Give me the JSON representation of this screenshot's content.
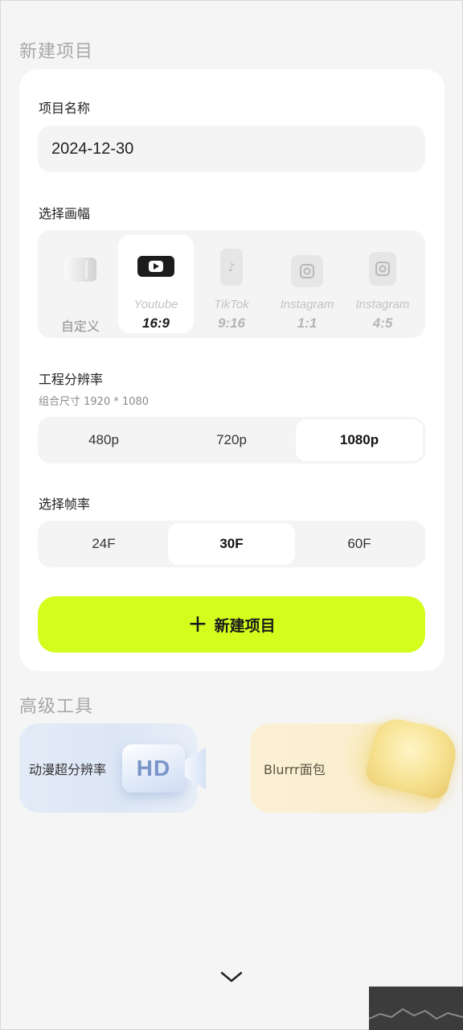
{
  "sections": {
    "new_project_title": "新建项目",
    "advanced_tools_title": "高级工具"
  },
  "project_name": {
    "label": "项目名称",
    "value": "2024-12-30"
  },
  "aspect": {
    "label": "选择画幅",
    "custom_label": "自定义",
    "options": [
      {
        "name": "Youtube",
        "ratio": "16:9",
        "icon": "youtube-icon",
        "selected": true
      },
      {
        "name": "TikTok",
        "ratio": "9:16",
        "icon": "tiktok-icon",
        "selected": false
      },
      {
        "name": "Instagram",
        "ratio": "1:1",
        "icon": "instagram-icon",
        "selected": false
      },
      {
        "name": "Instagram",
        "ratio": "4:5",
        "icon": "instagram-icon",
        "selected": false
      }
    ]
  },
  "resolution": {
    "label": "工程分辨率",
    "sublabel": "组合尺寸 1920 * 1080",
    "options": [
      "480p",
      "720p",
      "1080p"
    ],
    "selected": "1080p"
  },
  "framerate": {
    "label": "选择帧率",
    "options": [
      "24F",
      "30F",
      "60F"
    ],
    "selected": "30F"
  },
  "create_button": {
    "icon": "plus-icon",
    "label": "新建项目"
  },
  "tools": [
    {
      "label": "动漫超分辨率",
      "icon": "hd-camera-icon"
    },
    {
      "label": "Blurrr面包",
      "icon": "bread-icon"
    }
  ],
  "colors": {
    "accent": "#d4fc1c",
    "background": "#f5f5f5",
    "card": "#ffffff"
  }
}
